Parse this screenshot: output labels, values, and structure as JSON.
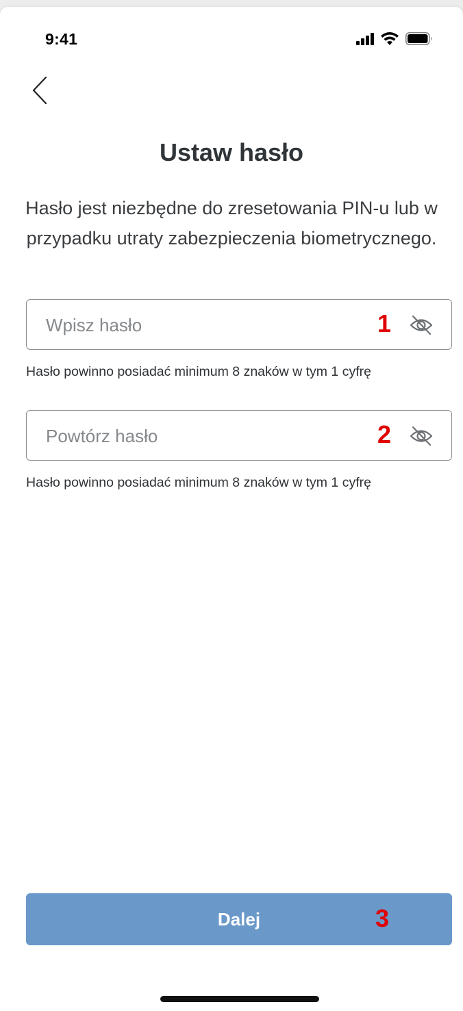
{
  "status_bar": {
    "time": "9:41",
    "icons": [
      "signal-icon",
      "wifi-icon",
      "battery-icon"
    ]
  },
  "header": {
    "back_icon": "chevron-left-icon"
  },
  "title": "Ustaw hasło",
  "description": "Hasło jest niezbędne do zresetowania PIN-u lub w przypadku utraty zabezpieczenia biometrycznego.",
  "fields": [
    {
      "placeholder": "Wpisz hasło",
      "value": "",
      "marker": "1",
      "toggle_icon": "eye-off-icon",
      "hint": "Hasło powinno posiadać minimum 8 znaków w tym 1 cyfrę"
    },
    {
      "placeholder": "Powtórz hasło",
      "value": "",
      "marker": "2",
      "toggle_icon": "eye-off-icon",
      "hint": "Hasło powinno posiadać minimum 8 znaków w tym 1 cyfrę"
    }
  ],
  "next_button": {
    "label": "Dalej",
    "marker": "3"
  },
  "colors": {
    "button_bg": "#6a98c9",
    "title": "#2f3438",
    "marker": "#e00000",
    "field_border": "#8c8f93"
  }
}
